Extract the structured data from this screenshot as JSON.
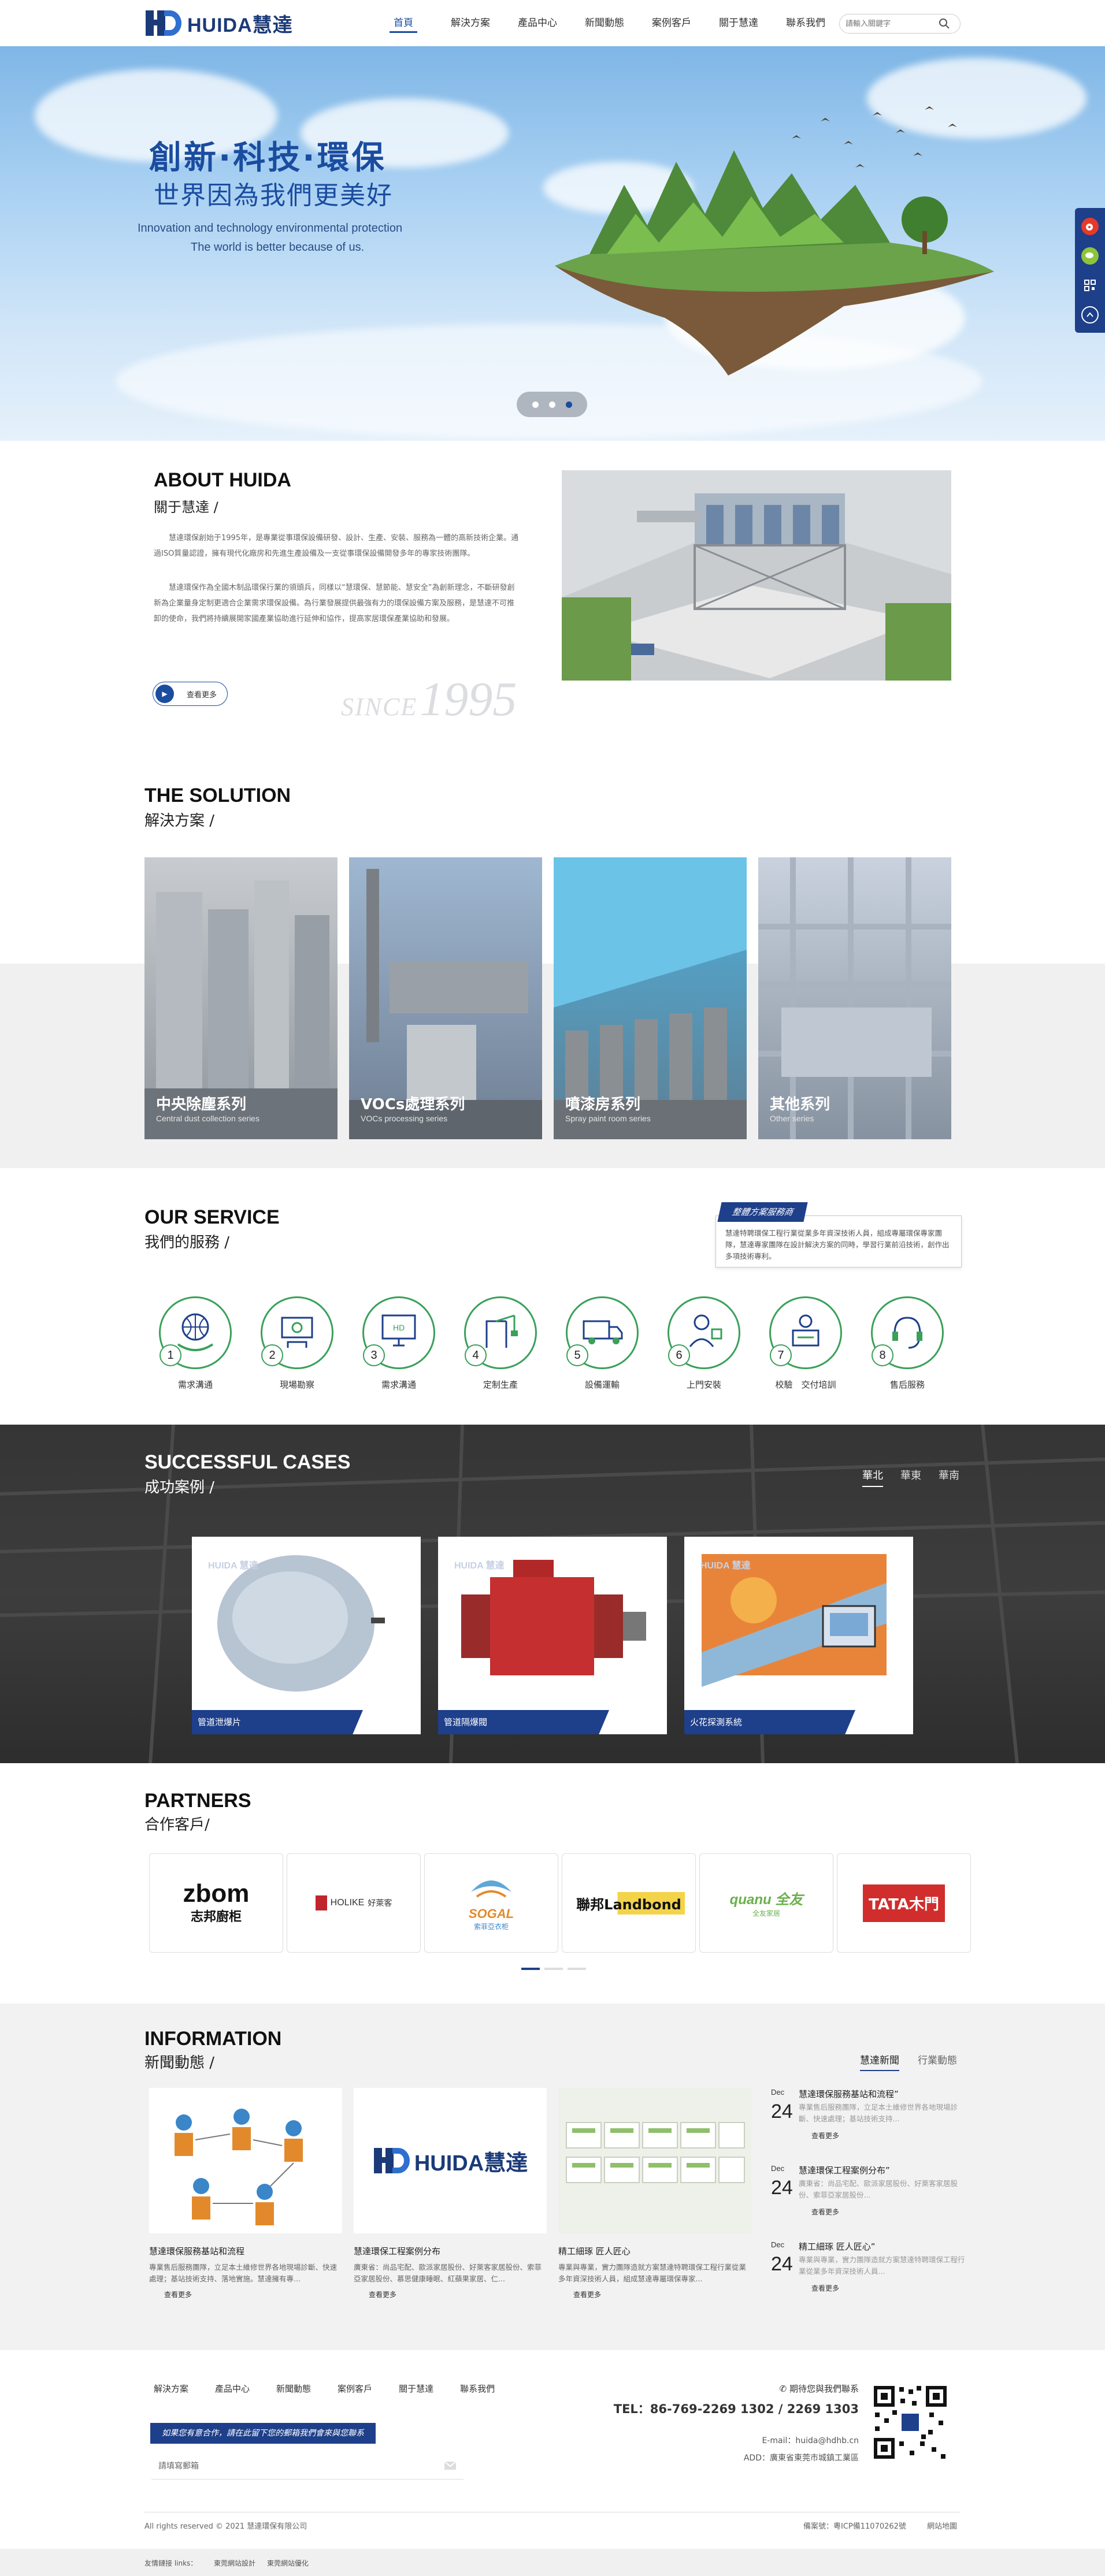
{
  "header": {
    "logo_text": "HUIDA",
    "logo_cn": "慧達",
    "nav": [
      "首頁",
      "解決方案",
      "產品中心",
      "新聞動態",
      "案例客戶",
      "關于慧達",
      "聯系我們"
    ],
    "search_placeholder": "請輸入關鍵字"
  },
  "hero": {
    "title": "創新·科技·環保",
    "subtitle": "世界因為我們更美好",
    "en_line1": "Innovation and technology environmental protection",
    "en_line2": "The world is better because of us."
  },
  "about": {
    "title_en": "ABOUT HUIDA",
    "title_cn": "關于慧達  /",
    "p1": "慧達環保創始于1995年，是專業從事環保設備研發、設計、生產、安裝、服務為一體的高新技術企業。通過ISO質量認證，擁有現代化廠房和先進生產設備及一支從事環保設備開發多年的專家技術團隊。",
    "p2": "慧達環保作為全國木制品環保行業的領頭兵，同樣以“慧環保、慧節能、慧安全”為創新理念，不斷研發創新為企業量身定制更適合企業需求環保設備。為行業發展提供最強有力的環保設備方案及服務，是慧達不可推卸的使命，我們將持續展開家國產業協助進行延伸和協作，提高家居環保產業協助和發展。",
    "more": "查看更多",
    "since_prefix": "SINCE",
    "since_year": "1995"
  },
  "solution": {
    "title_en": "THE SOLUTION",
    "title_cn": "解決方案  /",
    "cards": [
      {
        "cn": "中央除塵系列",
        "en": "Central dust collection series"
      },
      {
        "cn": "VOCs處理系列",
        "en": "VOCs processing series"
      },
      {
        "cn": "噴漆房系列",
        "en": "Spray paint room series"
      },
      {
        "cn": "其他系列",
        "en": "Other series"
      }
    ]
  },
  "service": {
    "title_en": "OUR SERVICE",
    "title_cn": "我們的服務  /",
    "notice_tag": "整體方案服務商",
    "notice_text": "慧達特聘環保工程行業從業多年資深技術人員，組成專屬環保專家團隊，慧達專家團隊在設計解決方案的同時，學習行業前沿技術，創作出多項技術專利。",
    "steps": [
      {
        "n": "1",
        "label": "需求溝通"
      },
      {
        "n": "2",
        "label": "現場勘察"
      },
      {
        "n": "3",
        "label": "需求溝通"
      },
      {
        "n": "4",
        "label": "定制生產"
      },
      {
        "n": "5",
        "label": "設備運輸"
      },
      {
        "n": "6",
        "label": "上門安裝"
      },
      {
        "n": "7",
        "label": "校驗　交付培訓"
      },
      {
        "n": "8",
        "label": "售后服務"
      }
    ]
  },
  "cases": {
    "title_en": "SUCCESSFUL CASES",
    "title_cn": "成功案例  /",
    "tabs": [
      "華北",
      "華東",
      "華南"
    ],
    "watermark": "HUIDA 慧達",
    "items": [
      "管道泄爆片",
      "管道隔爆閥",
      "火花探測系統"
    ]
  },
  "partners": {
    "title_en": "PARTNERS",
    "title_cn": "合作客戶/",
    "logos": [
      {
        "a": "zbom",
        "b": "志邦廚柜"
      },
      {
        "a": "HOLIKE",
        "b": "好萊客"
      },
      {
        "a": "SOGAL",
        "b": "索菲亞衣柜"
      },
      {
        "a": "聯邦Landbond",
        "b": ""
      },
      {
        "a": "quanu 全友",
        "b": "全友家居"
      },
      {
        "a": "TATA木門",
        "b": ""
      }
    ]
  },
  "info": {
    "title_en": "INFORMATION",
    "title_cn": "新聞動態  /",
    "tabs": [
      "慧達新聞",
      "行業動態"
    ],
    "cards": [
      {
        "title": "慧達環保服務基站和流程",
        "desc": "專業售后服務團隊，立足本土維修世界各地現場診斷、快速處理；基站技術支持、落地實施。慧達擁有專...",
        "more": "查看更多"
      },
      {
        "title": "慧達環保工程案例分布",
        "desc": "廣東省：尚品宅配、歐派家居股份、好萊客家居股份、索菲亞家居股份、慕思健康睡眠、紅蘋果家居、仁...",
        "more": "查看更多"
      },
      {
        "title": "精工細琢 匠人匠心",
        "desc": "專業與專業，實力團隊造就方案慧達特聘環保工程行業從業多年資深技術人員，組成慧達專屬環保專家...",
        "more": "查看更多"
      }
    ],
    "logo_text": "HUIDA",
    "logo_cn": "慧達",
    "side": [
      {
        "dec": "Dec",
        "day": "24",
        "title": "慧達環保服務基站和流程”",
        "desc": "專業售后服務團隊，立足本土維修世界各地現場診斷、快速處理；基站技術支持...",
        "more": "查看更多"
      },
      {
        "dec": "Dec",
        "day": "24",
        "title": "慧達環保工程案例分布”",
        "desc": "廣東省：尚品宅配、歐派家居股份、好萊客家居股份、索菲亞家居股份...",
        "more": "查看更多"
      },
      {
        "dec": "Dec",
        "day": "24",
        "title": "精工細琢 匠人匠心”",
        "desc": "專業與專業，實力團隊造就方案慧達特聘環保工程行業從業多年資深技術人員...",
        "more": "查看更多"
      }
    ]
  },
  "footer": {
    "nav": [
      "解決方案",
      "產品中心",
      "新聞動態",
      "案例客戶",
      "關于慧達",
      "聯系我們"
    ],
    "banner": "如果您有意合作，請在此留下您的郵箱我們會來與您聯系",
    "input_placeholder": "請填寫郵箱",
    "contact_title": "期待您與我們聯系",
    "tel": "TEL：86-769-2269 1302 / 2269 1303",
    "email": "E-mail：huida@hdhb.cn",
    "address": "ADD：廣東省東莞市城鎮工業區",
    "copyright": "All rights reserved © 2021 慧達環保有限公司",
    "icp": "備案號：粵ICP備11070262號",
    "sitemap": "網站地圖",
    "links_label": "友情鏈接 links：",
    "links": [
      "東莞網站設計",
      "東莞網站優化"
    ]
  },
  "colors": {
    "brand": "#1e3f8a",
    "accent_green": "#3aa05a",
    "dark": "#353535"
  }
}
